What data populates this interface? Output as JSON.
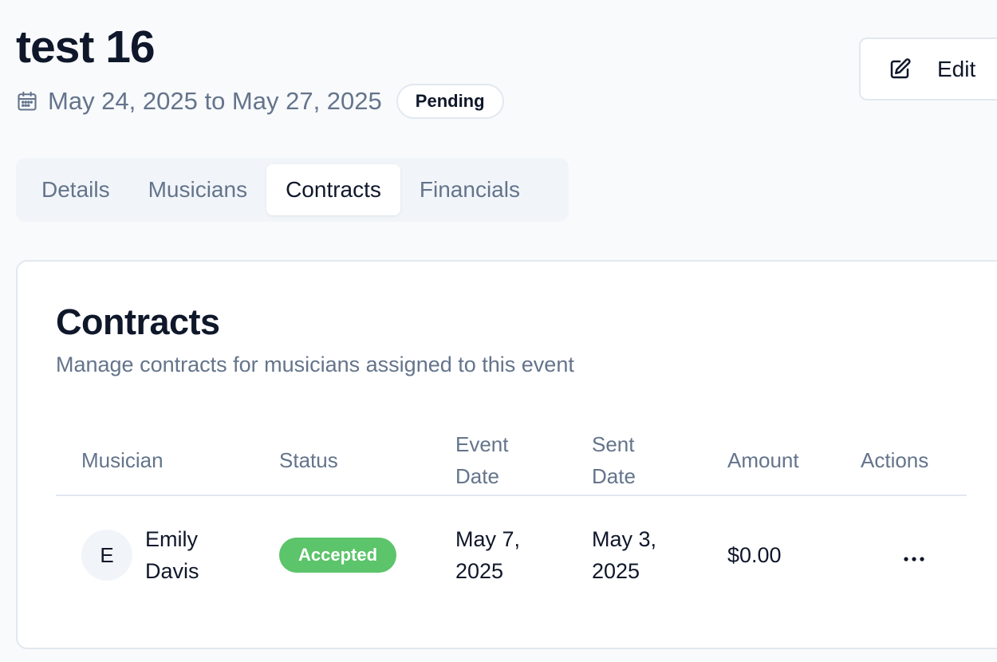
{
  "header": {
    "title": "test 16",
    "date_range": "May 24, 2025 to May 27, 2025",
    "status": "Pending",
    "edit_label": "Edit",
    "calendar_icon": "calendar-icon",
    "edit_icon": "pencil-square-icon"
  },
  "tabs": [
    {
      "label": "Details",
      "active": false
    },
    {
      "label": "Musicians",
      "active": false
    },
    {
      "label": "Contracts",
      "active": true
    },
    {
      "label": "Financials",
      "active": false
    }
  ],
  "contracts": {
    "title": "Contracts",
    "subtitle": "Manage contracts for musicians assigned to this event",
    "columns": {
      "musician": "Musician",
      "status": "Status",
      "event_date": "Event Date",
      "sent_date": "Sent Date",
      "amount": "Amount",
      "actions": "Actions"
    },
    "rows": [
      {
        "initial": "E",
        "musician": "Emily Davis",
        "status": "Accepted",
        "event_date": "May 7, 2025",
        "sent_date": "May 3, 2025",
        "amount": "$0.00",
        "actions_icon": "more-horizontal-icon"
      }
    ]
  },
  "colors": {
    "accepted": "#5cc46a",
    "muted_text": "#64748b",
    "border": "#e2e8f0",
    "tab_bg": "#f1f5f9"
  }
}
